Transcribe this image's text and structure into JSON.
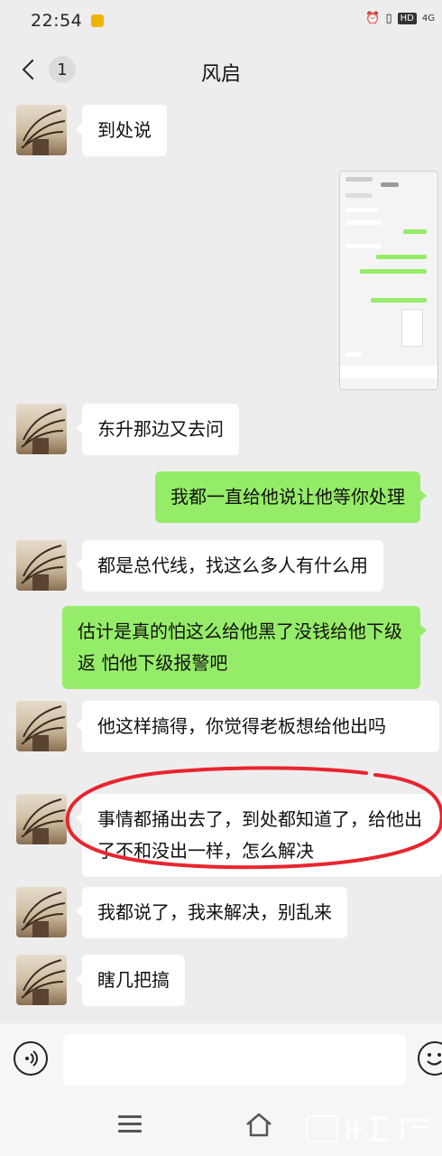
{
  "status_bar": {
    "time": "22:54",
    "hd_label": "HD",
    "net_label": "4G"
  },
  "header": {
    "unread_count": "1",
    "title": "风启"
  },
  "messages": [
    {
      "side": "left",
      "text": "到处说"
    },
    {
      "side": "left",
      "type": "image"
    },
    {
      "side": "left",
      "text": "东升那边又去问"
    },
    {
      "side": "right",
      "text": "我都一直给他说让他等你处理"
    },
    {
      "side": "left",
      "text": "都是总代线，找这么多人有什么用"
    },
    {
      "side": "right",
      "text": "估计是真的怕这么给他黑了没钱给他下级返  怕他下级报警吧"
    },
    {
      "side": "left",
      "text": "他这样搞得，你觉得老板想给他出吗"
    },
    {
      "side": "left",
      "text": "事情都捅出去了，到处都知道了，给他出了不和没出一样，怎么解决"
    },
    {
      "side": "left",
      "text": "我都说了，我来解决，别乱来"
    },
    {
      "side": "left",
      "text": "瞎几把搞"
    }
  ],
  "input": {
    "value": "",
    "placeholder": ""
  },
  "colors": {
    "sent_bubble": "#95ec69",
    "received_bubble": "#ffffff",
    "annotation": "#e8252f"
  },
  "icons": {
    "back": "chevron-left-icon",
    "voice": "voice-icon",
    "emoji": "emoji-icon",
    "menu": "menu-icon",
    "home": "home-icon"
  }
}
